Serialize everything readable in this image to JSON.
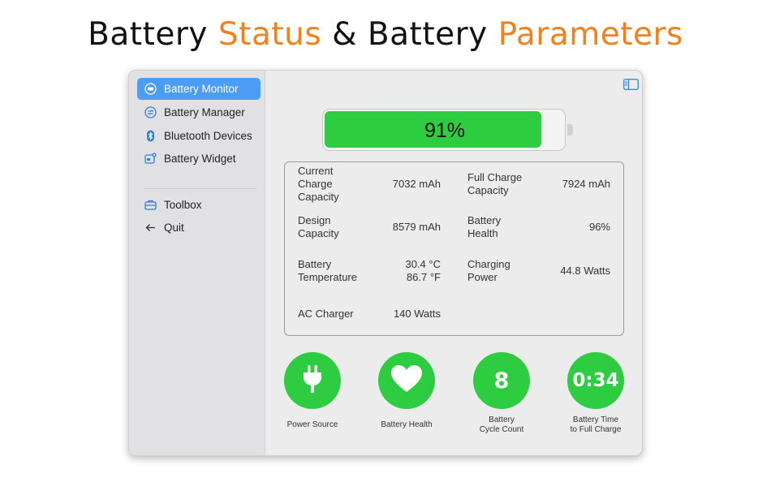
{
  "headline": {
    "part1": "Battery",
    "part2": "Status",
    "part3": "& Battery",
    "part4": "Parameters"
  },
  "colors": {
    "accent": "#f0821e",
    "green": "#2ecc40",
    "selection": "#4a9cf5"
  },
  "sidebar": {
    "items": [
      {
        "label": "Battery Monitor",
        "icon": "battery-monitor-icon",
        "active": true
      },
      {
        "label": "Battery Manager",
        "icon": "battery-manager-icon"
      },
      {
        "label": "Bluetooth Devices",
        "icon": "bluetooth-icon"
      },
      {
        "label": "Battery Widget",
        "icon": "widget-icon"
      }
    ],
    "tools": [
      {
        "label": "Toolbox",
        "icon": "toolbox-icon"
      },
      {
        "label": "Quit",
        "icon": "arrow-left-icon"
      }
    ]
  },
  "battery": {
    "percent_label": "91%",
    "level": 0.91
  },
  "params": {
    "current_charge": {
      "label": [
        "Current",
        "Charge",
        "Capacity"
      ],
      "value": "7032 mAh"
    },
    "full_charge": {
      "label": [
        "Full Charge",
        "Capacity"
      ],
      "value": "7924 mAh"
    },
    "design_capacity": {
      "label": [
        "Design",
        "Capacity"
      ],
      "value": "8579 mAh"
    },
    "battery_health": {
      "label": [
        "Battery",
        "Health"
      ],
      "value": "96%"
    },
    "temperature": {
      "label": [
        "Battery",
        "Temperature"
      ],
      "value_c": "30.4 °C",
      "value_f": "86.7 °F"
    },
    "charging_power": {
      "label": [
        "Charging",
        "Power"
      ],
      "value": "44.8 Watts"
    },
    "ac_charger": {
      "label": "AC Charger",
      "value": "140 Watts"
    }
  },
  "stats": {
    "power_source": {
      "caption": "Power Source",
      "icon": "plug-icon"
    },
    "battery_health": {
      "caption": "Battery Health",
      "icon": "heart-icon"
    },
    "cycle_count": {
      "value": "8",
      "caption": [
        "Battery",
        "Cycle Count"
      ]
    },
    "time_to_full": {
      "value": "0:34",
      "caption": [
        "Battery Time",
        "to Full Charge"
      ]
    }
  }
}
